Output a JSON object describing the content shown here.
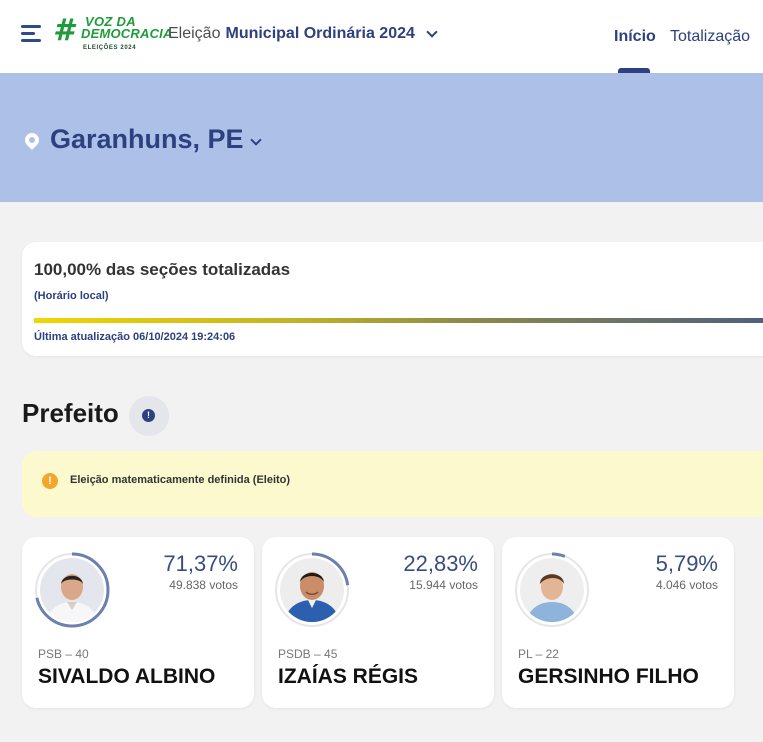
{
  "header": {
    "logo": {
      "hashtag": "#",
      "line1": "VOZ DA",
      "line2": "DEMOCRACIA",
      "line3": "ELEIÇÕES 2024"
    },
    "election_prefix": "Eleição",
    "election_name": "Municipal Ordinária 2024",
    "tabs": [
      {
        "label": "Início",
        "active": true
      },
      {
        "label": "Totalização",
        "active": false
      }
    ]
  },
  "location": {
    "city": "Garanhuns, PE"
  },
  "progress": {
    "title": "100,00% das seções totalizadas",
    "subtitle": "(Horário local)",
    "percent": 100,
    "last_update": "Última atualização 06/10/2024 19:24:06"
  },
  "section": {
    "title": "Prefeito",
    "info_icon": "info-icon"
  },
  "alert": {
    "icon": "warning-info-icon",
    "text": "Eleição matematicamente definida (Eleito)"
  },
  "candidates": [
    {
      "percent": "71,37%",
      "votes": "49.838 votos",
      "party": "PSB – 40",
      "name": "SIVALDO ALBINO",
      "share": 0.7137
    },
    {
      "percent": "22,83%",
      "votes": "15.944 votos",
      "party": "PSDB – 45",
      "name": "IZAÍAS RÉGIS",
      "share": 0.2283
    },
    {
      "percent": "5,79%",
      "votes": "4.046 votos",
      "party": "PL – 22",
      "name": "GERSINHO FILHO",
      "share": 0.0579
    }
  ],
  "colors": {
    "brand": "#2d4080",
    "banner": "#adc0e8",
    "logo_green": "#1e9b3a",
    "alert_bg": "#fdf9cf",
    "alert_icon": "#f2a62c",
    "ring": "#6c7fb0"
  }
}
